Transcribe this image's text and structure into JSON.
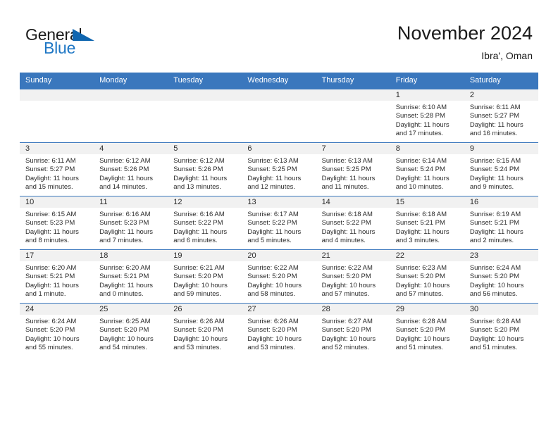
{
  "brand": {
    "name_part1": "General",
    "name_part2": "Blue",
    "logo_icon": "blue-triangle",
    "color_blue": "#1d76c4",
    "color_triangle": "#1066b0"
  },
  "header": {
    "title": "November 2024",
    "subtitle": "Ibra', Oman"
  },
  "theme": {
    "header_bg": "#3a77bd",
    "date_band_bg": "#f1f1f1",
    "cell_bg": "#ffffff",
    "text": "#2b2b2b"
  },
  "weekdays": [
    "Sunday",
    "Monday",
    "Tuesday",
    "Wednesday",
    "Thursday",
    "Friday",
    "Saturday"
  ],
  "weeks": [
    [
      {
        "day": "",
        "sunrise": "",
        "sunset": "",
        "daylight": ""
      },
      {
        "day": "",
        "sunrise": "",
        "sunset": "",
        "daylight": ""
      },
      {
        "day": "",
        "sunrise": "",
        "sunset": "",
        "daylight": ""
      },
      {
        "day": "",
        "sunrise": "",
        "sunset": "",
        "daylight": ""
      },
      {
        "day": "",
        "sunrise": "",
        "sunset": "",
        "daylight": ""
      },
      {
        "day": "1",
        "sunrise": "Sunrise: 6:10 AM",
        "sunset": "Sunset: 5:28 PM",
        "daylight": "Daylight: 11 hours and 17 minutes."
      },
      {
        "day": "2",
        "sunrise": "Sunrise: 6:11 AM",
        "sunset": "Sunset: 5:27 PM",
        "daylight": "Daylight: 11 hours and 16 minutes."
      }
    ],
    [
      {
        "day": "3",
        "sunrise": "Sunrise: 6:11 AM",
        "sunset": "Sunset: 5:27 PM",
        "daylight": "Daylight: 11 hours and 15 minutes."
      },
      {
        "day": "4",
        "sunrise": "Sunrise: 6:12 AM",
        "sunset": "Sunset: 5:26 PM",
        "daylight": "Daylight: 11 hours and 14 minutes."
      },
      {
        "day": "5",
        "sunrise": "Sunrise: 6:12 AM",
        "sunset": "Sunset: 5:26 PM",
        "daylight": "Daylight: 11 hours and 13 minutes."
      },
      {
        "day": "6",
        "sunrise": "Sunrise: 6:13 AM",
        "sunset": "Sunset: 5:25 PM",
        "daylight": "Daylight: 11 hours and 12 minutes."
      },
      {
        "day": "7",
        "sunrise": "Sunrise: 6:13 AM",
        "sunset": "Sunset: 5:25 PM",
        "daylight": "Daylight: 11 hours and 11 minutes."
      },
      {
        "day": "8",
        "sunrise": "Sunrise: 6:14 AM",
        "sunset": "Sunset: 5:24 PM",
        "daylight": "Daylight: 11 hours and 10 minutes."
      },
      {
        "day": "9",
        "sunrise": "Sunrise: 6:15 AM",
        "sunset": "Sunset: 5:24 PM",
        "daylight": "Daylight: 11 hours and 9 minutes."
      }
    ],
    [
      {
        "day": "10",
        "sunrise": "Sunrise: 6:15 AM",
        "sunset": "Sunset: 5:23 PM",
        "daylight": "Daylight: 11 hours and 8 minutes."
      },
      {
        "day": "11",
        "sunrise": "Sunrise: 6:16 AM",
        "sunset": "Sunset: 5:23 PM",
        "daylight": "Daylight: 11 hours and 7 minutes."
      },
      {
        "day": "12",
        "sunrise": "Sunrise: 6:16 AM",
        "sunset": "Sunset: 5:22 PM",
        "daylight": "Daylight: 11 hours and 6 minutes."
      },
      {
        "day": "13",
        "sunrise": "Sunrise: 6:17 AM",
        "sunset": "Sunset: 5:22 PM",
        "daylight": "Daylight: 11 hours and 5 minutes."
      },
      {
        "day": "14",
        "sunrise": "Sunrise: 6:18 AM",
        "sunset": "Sunset: 5:22 PM",
        "daylight": "Daylight: 11 hours and 4 minutes."
      },
      {
        "day": "15",
        "sunrise": "Sunrise: 6:18 AM",
        "sunset": "Sunset: 5:21 PM",
        "daylight": "Daylight: 11 hours and 3 minutes."
      },
      {
        "day": "16",
        "sunrise": "Sunrise: 6:19 AM",
        "sunset": "Sunset: 5:21 PM",
        "daylight": "Daylight: 11 hours and 2 minutes."
      }
    ],
    [
      {
        "day": "17",
        "sunrise": "Sunrise: 6:20 AM",
        "sunset": "Sunset: 5:21 PM",
        "daylight": "Daylight: 11 hours and 1 minute."
      },
      {
        "day": "18",
        "sunrise": "Sunrise: 6:20 AM",
        "sunset": "Sunset: 5:21 PM",
        "daylight": "Daylight: 11 hours and 0 minutes."
      },
      {
        "day": "19",
        "sunrise": "Sunrise: 6:21 AM",
        "sunset": "Sunset: 5:20 PM",
        "daylight": "Daylight: 10 hours and 59 minutes."
      },
      {
        "day": "20",
        "sunrise": "Sunrise: 6:22 AM",
        "sunset": "Sunset: 5:20 PM",
        "daylight": "Daylight: 10 hours and 58 minutes."
      },
      {
        "day": "21",
        "sunrise": "Sunrise: 6:22 AM",
        "sunset": "Sunset: 5:20 PM",
        "daylight": "Daylight: 10 hours and 57 minutes."
      },
      {
        "day": "22",
        "sunrise": "Sunrise: 6:23 AM",
        "sunset": "Sunset: 5:20 PM",
        "daylight": "Daylight: 10 hours and 57 minutes."
      },
      {
        "day": "23",
        "sunrise": "Sunrise: 6:24 AM",
        "sunset": "Sunset: 5:20 PM",
        "daylight": "Daylight: 10 hours and 56 minutes."
      }
    ],
    [
      {
        "day": "24",
        "sunrise": "Sunrise: 6:24 AM",
        "sunset": "Sunset: 5:20 PM",
        "daylight": "Daylight: 10 hours and 55 minutes."
      },
      {
        "day": "25",
        "sunrise": "Sunrise: 6:25 AM",
        "sunset": "Sunset: 5:20 PM",
        "daylight": "Daylight: 10 hours and 54 minutes."
      },
      {
        "day": "26",
        "sunrise": "Sunrise: 6:26 AM",
        "sunset": "Sunset: 5:20 PM",
        "daylight": "Daylight: 10 hours and 53 minutes."
      },
      {
        "day": "27",
        "sunrise": "Sunrise: 6:26 AM",
        "sunset": "Sunset: 5:20 PM",
        "daylight": "Daylight: 10 hours and 53 minutes."
      },
      {
        "day": "28",
        "sunrise": "Sunrise: 6:27 AM",
        "sunset": "Sunset: 5:20 PM",
        "daylight": "Daylight: 10 hours and 52 minutes."
      },
      {
        "day": "29",
        "sunrise": "Sunrise: 6:28 AM",
        "sunset": "Sunset: 5:20 PM",
        "daylight": "Daylight: 10 hours and 51 minutes."
      },
      {
        "day": "30",
        "sunrise": "Sunrise: 6:28 AM",
        "sunset": "Sunset: 5:20 PM",
        "daylight": "Daylight: 10 hours and 51 minutes."
      }
    ]
  ]
}
